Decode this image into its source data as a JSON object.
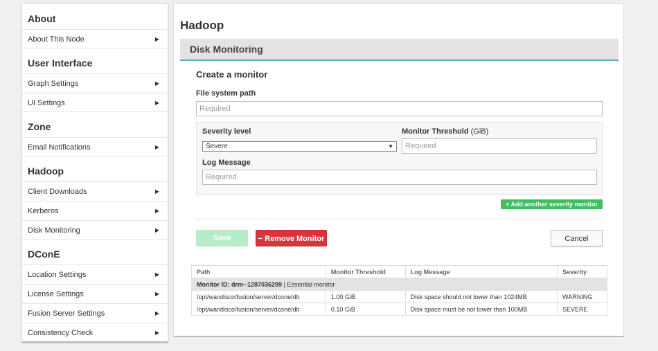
{
  "sidebar": {
    "sections": [
      {
        "title": "About",
        "items": [
          "About This Node"
        ]
      },
      {
        "title": "User Interface",
        "items": [
          "Graph Settings",
          "UI Settings"
        ]
      },
      {
        "title": "Zone",
        "items": [
          "Email Notifications"
        ]
      },
      {
        "title": "Hadoop",
        "items": [
          "Client Downloads",
          "Kerberos",
          "Disk Monitoring"
        ]
      },
      {
        "title": "DConE",
        "items": [
          "Location Settings",
          "License Settings",
          "Fusion Server Settings",
          "Consistency Check"
        ]
      }
    ],
    "arrow": "▶"
  },
  "main": {
    "page_title": "Hadoop",
    "section_title": "Disk Monitoring",
    "card_title": "Create a monitor",
    "file_system_path": {
      "label": "File system path",
      "placeholder": "Required",
      "value": ""
    },
    "severity": {
      "label": "Severity level",
      "selected": "Severe",
      "caret": "▼"
    },
    "threshold": {
      "label": "Monitor Threshold",
      "unit": "(GiB)",
      "placeholder": "Required"
    },
    "log_message": {
      "label": "Log Message",
      "placeholder": "Required"
    },
    "add_severity_label": "+ Add another severity monitor",
    "save_label": "Save",
    "remove_label": "− Remove Monitor",
    "cancel_label": "Cancel",
    "table": {
      "headers": [
        "Path",
        "Monitor Threshold",
        "Log Message",
        "Severity"
      ],
      "group_id": "Monitor ID: drm--1287036299",
      "group_note": "| Essential monitor",
      "rows": [
        [
          "/opt/wandisco/fusion/server/dcone/db",
          "1.00 GiB",
          "Disk space should not lower than 1024MB",
          "WARNING"
        ],
        [
          "/opt/wandisco/fusion/server/dcone/db",
          "0.10 GiB",
          "Disk space must be not lower than 100MB",
          "SEVERE"
        ]
      ]
    }
  },
  "colors": {
    "accent": "#5aa7c0",
    "add_button": "#3dbf62",
    "save_disabled": "#b7ecc9",
    "remove": "#d9353c"
  }
}
